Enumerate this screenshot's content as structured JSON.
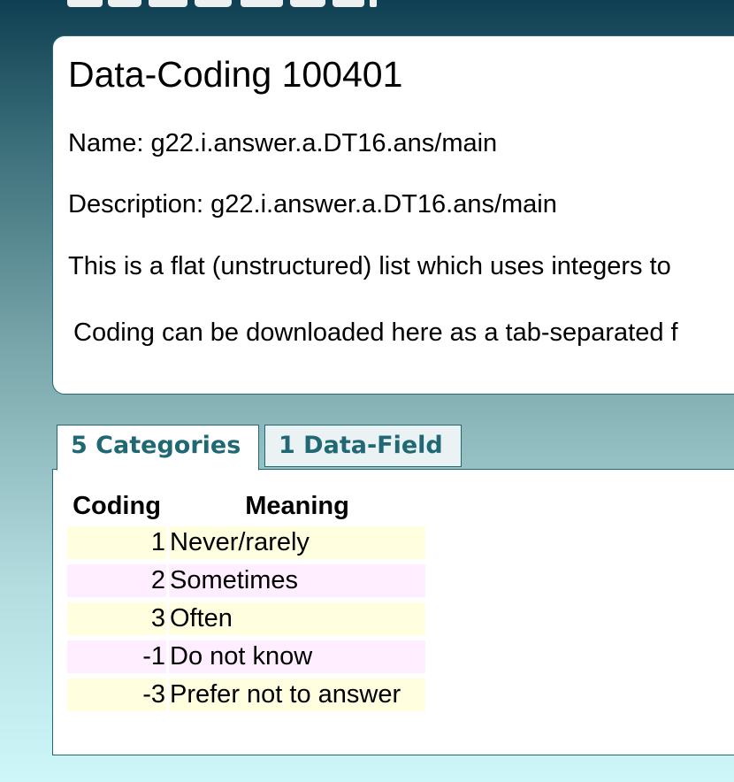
{
  "page": {
    "title": "Data-Coding 100401",
    "name_line": "Name: g22.i.answer.a.DT16.ans/main",
    "description_line": "Description: g22.i.answer.a.DT16.ans/main",
    "flat_line": "This is a flat (unstructured) list which uses integers to",
    "download_line": "Coding can be downloaded here as a tab-separated f"
  },
  "tabs": [
    {
      "label": "5 Categories",
      "selected": true
    },
    {
      "label": "1 Data-Field",
      "selected": false
    }
  ],
  "table": {
    "headers": {
      "coding": "Coding",
      "meaning": "Meaning"
    },
    "rows": [
      {
        "coding": "1",
        "meaning": "Never/rarely"
      },
      {
        "coding": "2",
        "meaning": "Sometimes"
      },
      {
        "coding": "3",
        "meaning": "Often"
      },
      {
        "coding": "-1",
        "meaning": "Do not know"
      },
      {
        "coding": "-3",
        "meaning": "Prefer not to answer"
      }
    ]
  },
  "colors": {
    "accent": "#1f6874",
    "row_odd": "#ffffe0",
    "row_even": "#ffeeff"
  }
}
